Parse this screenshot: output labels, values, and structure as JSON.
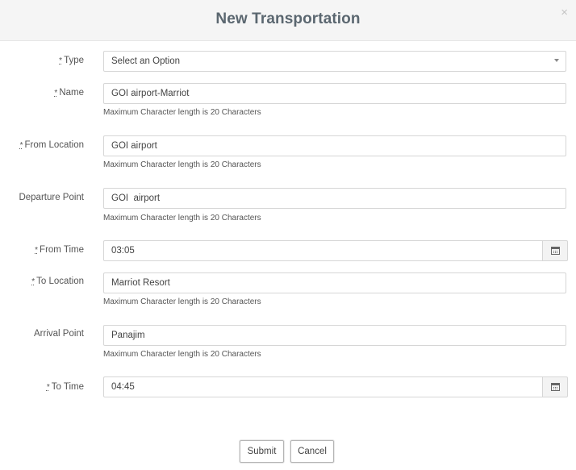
{
  "modal": {
    "title": "New Transportation",
    "close_label": "×"
  },
  "required_marker": "*",
  "fields": {
    "type": {
      "label": "Type",
      "value": "Select an Option"
    },
    "name": {
      "label": "Name",
      "value": "GOI airport-Marriot",
      "help": "Maximum Character length is 20 Characters"
    },
    "from_location": {
      "label": "From Location",
      "value": "GOI airport",
      "help": "Maximum Character length is 20 Characters"
    },
    "departure_point": {
      "label": "Departure Point",
      "value": "GOI  airport",
      "help": "Maximum Character length is 20 Characters"
    },
    "from_time": {
      "label": "From Time",
      "value": "03:05"
    },
    "to_location": {
      "label": "To Location",
      "value": "Marriot Resort",
      "help": "Maximum Character length is 20 Characters"
    },
    "arrival_point": {
      "label": "Arrival Point",
      "value": "Panajim",
      "help": "Maximum Character length is 20 Characters"
    },
    "to_time": {
      "label": "To Time",
      "value": "04:45"
    }
  },
  "buttons": {
    "submit": "Submit",
    "cancel": "Cancel"
  },
  "icons": {
    "close": "close-icon",
    "calendar": "calendar-icon",
    "dropdown": "chevron-down-icon"
  }
}
